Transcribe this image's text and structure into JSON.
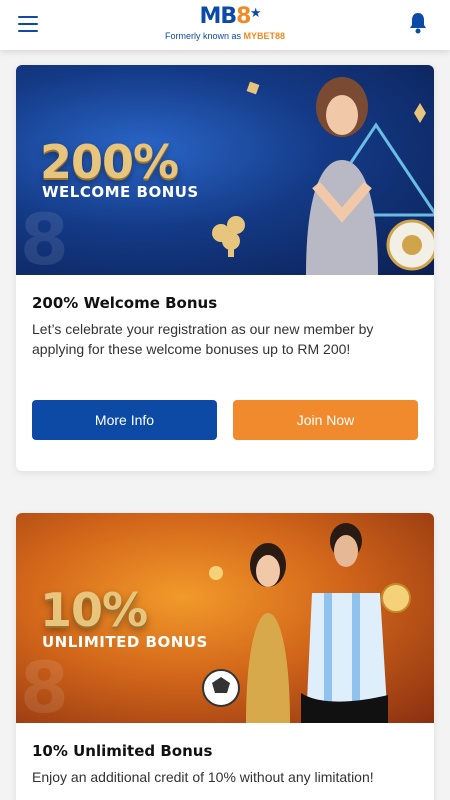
{
  "header": {
    "logo_main": "MB",
    "logo_eight": "8",
    "logo_sub_prefix": "Formerly known as",
    "logo_sub_brand": "MYBET88",
    "icons": {
      "menu": "hamburger-menu-icon",
      "notifications": "bell-icon"
    }
  },
  "colors": {
    "brand_blue": "#0d4aa6",
    "brand_orange": "#f08a2c",
    "page_bg": "#f3f3f3"
  },
  "promotions": [
    {
      "banner_percent": "200%",
      "banner_subtitle": "WELCOME BONUS",
      "banner_watermark": "8",
      "title": "200% Welcome Bonus",
      "description": "Let’s celebrate your registration as our new member by applying for these welcome bonuses up to RM 200!",
      "more_info_label": "More Info",
      "join_now_label": "Join Now"
    },
    {
      "banner_percent": "10%",
      "banner_subtitle": "UNLIMITED BONUS",
      "banner_watermark": "8",
      "title": "10% Unlimited Bonus",
      "description": "Enjoy an additional credit of 10% without any limitation!"
    }
  ]
}
